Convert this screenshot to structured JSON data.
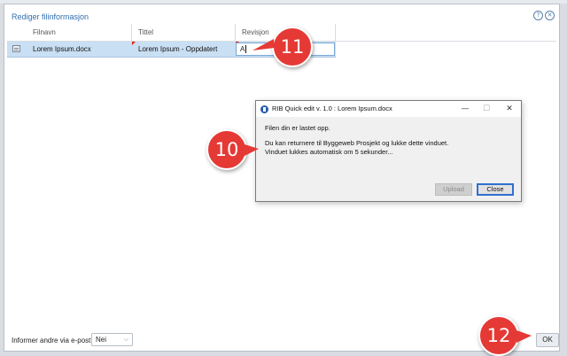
{
  "dialog": {
    "title": "Rediger filinformasjon",
    "icons": [
      "help-icon",
      "close-icon"
    ]
  },
  "grid": {
    "columns": [
      "Filnavn",
      "Tittel",
      "Revisjon"
    ],
    "rows": [
      {
        "filename": "Lorem Ipsum.docx",
        "title": "Lorem Ipsum - Oppdatert",
        "revision": "A"
      }
    ]
  },
  "footer": {
    "notify_label": "Informer andre via e-post:",
    "notify_value": "Nei",
    "ok_label": "OK"
  },
  "popup": {
    "title": "RIB Quick edit v. 1.0 : Lorem Ipsum.docx",
    "line1": "Filen din er lastet opp.",
    "line2": "Du kan returnere til Byggeweb Prosjekt og lukke dette vinduet.",
    "line3": "Vinduet lukkes automatisk om 5 sekunder...",
    "upload_label": "Upload",
    "close_label": "Close",
    "controls": {
      "minimize": "—",
      "maximize": "☐",
      "close": "✕"
    }
  },
  "callouts": {
    "a": "11",
    "b": "10",
    "c": "12"
  },
  "colors": {
    "accent": "#2f6fb0",
    "callout": "#e53935",
    "selected_row": "#c9dff3"
  }
}
